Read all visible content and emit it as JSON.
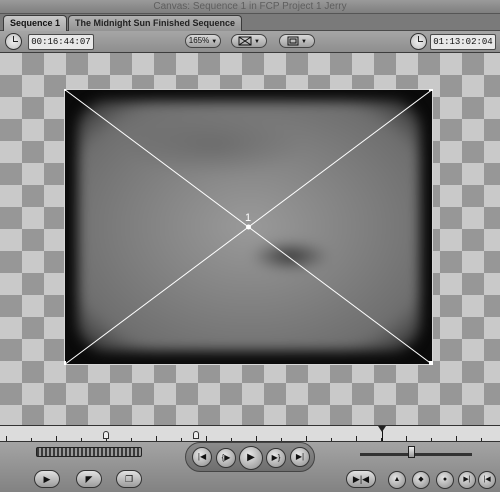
{
  "window": {
    "title": "Canvas: Sequence 1 in FCP Project 1 Jerry"
  },
  "tabs": [
    {
      "label": "Sequence 1",
      "active": true
    },
    {
      "label": "The Midnight Sun Finished Sequence",
      "active": false
    }
  ],
  "toolbar": {
    "duration_timecode": "00:16:44:07",
    "zoom_label": "165%",
    "current_timecode": "01:13:02:04"
  },
  "viewer": {
    "wireframe_label": "1"
  },
  "icons": {
    "duration_clock": "clock-icon",
    "current_clock": "clock-icon",
    "view_options": "view-mode-icon",
    "overlay_options": "overlay-icon",
    "go_prev_edit": "previous-edit-icon",
    "play_in_to_out": "play-in-out-icon",
    "play": "play-icon",
    "play_around": "play-around-icon",
    "go_next_edit": "next-edit-icon",
    "insert": "insert-edit-icon",
    "overwrite": "overwrite-edit-icon",
    "replace": "replace-edit-icon",
    "match_frame": "match-frame-icon",
    "mark_clip": "mark-clip-icon",
    "add_keyframe": "add-keyframe-icon",
    "add_marker": "add-marker-icon",
    "mark_in": "mark-in-icon",
    "mark_out": "mark-out-icon"
  },
  "colors": {
    "checker_light": "#c9c9c9",
    "checker_dark": "#979797",
    "wireframe": "#ffffff"
  }
}
